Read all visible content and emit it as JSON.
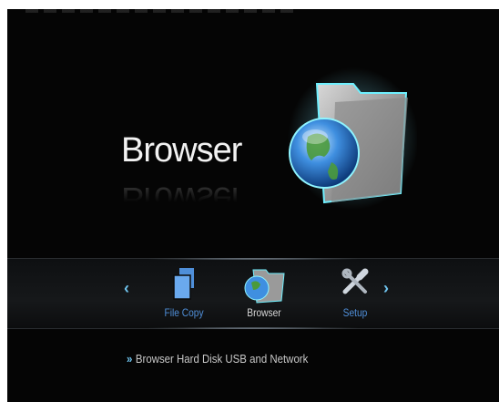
{
  "hero": {
    "title": "Browser",
    "reflection": "Browser",
    "icon": "globe-folder-icon"
  },
  "nav": {
    "items": [
      {
        "label": "File Copy",
        "icon": "file-copy-icon",
        "selected": false
      },
      {
        "label": "Browser",
        "icon": "globe-folder-icon",
        "selected": true
      },
      {
        "label": "Setup",
        "icon": "tools-icon",
        "selected": false
      }
    ],
    "left_arrow": "‹",
    "right_arrow": "›"
  },
  "description": {
    "bullet": "»",
    "text": "Browser Hard Disk USB and Network"
  },
  "colors": {
    "accent": "#6fc4ee",
    "label_blue": "#4f8fd9",
    "background": "#050505"
  }
}
